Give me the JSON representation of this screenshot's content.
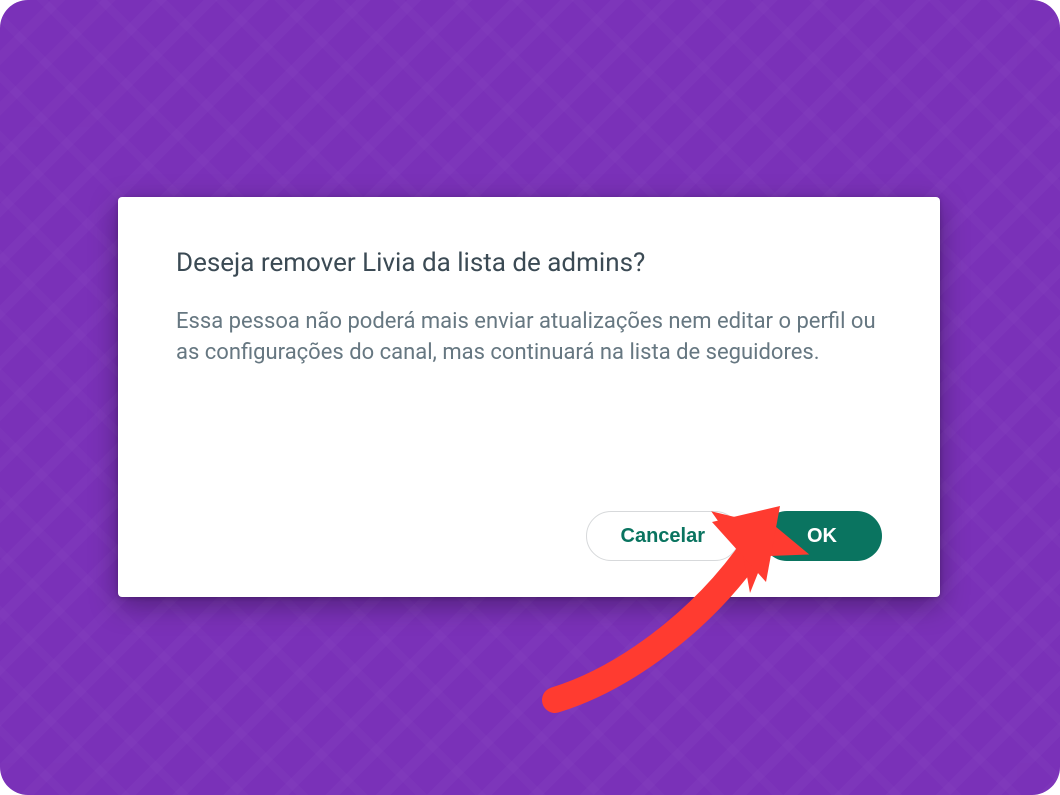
{
  "dialog": {
    "title": "Deseja remover Livia da lista de admins?",
    "body": "Essa pessoa não poderá mais enviar atualizações nem editar o perfil ou as configurações do canal, mas continuará na lista de seguidores.",
    "cancel_label": "Cancelar",
    "ok_label": "OK"
  },
  "annotation": {
    "arrow_color": "#ff3b30"
  }
}
